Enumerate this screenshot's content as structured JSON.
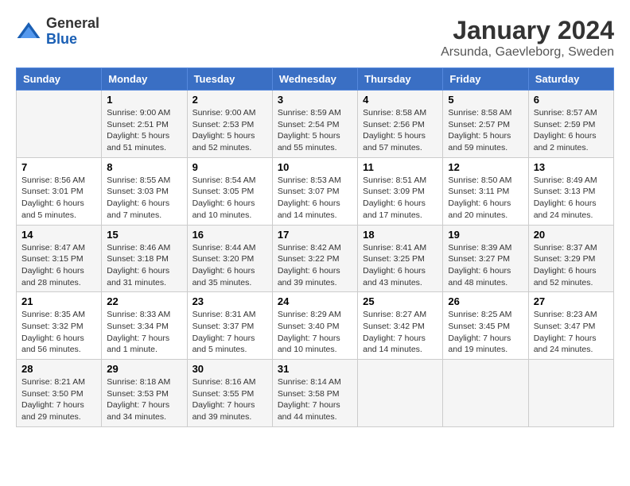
{
  "logo": {
    "general": "General",
    "blue": "Blue"
  },
  "header": {
    "month": "January 2024",
    "location": "Arsunda, Gaevleborg, Sweden"
  },
  "weekdays": [
    "Sunday",
    "Monday",
    "Tuesday",
    "Wednesday",
    "Thursday",
    "Friday",
    "Saturday"
  ],
  "weeks": [
    [
      {
        "day": "",
        "sunrise": "",
        "sunset": "",
        "daylight": ""
      },
      {
        "day": "1",
        "sunrise": "Sunrise: 9:00 AM",
        "sunset": "Sunset: 2:51 PM",
        "daylight": "Daylight: 5 hours and 51 minutes."
      },
      {
        "day": "2",
        "sunrise": "Sunrise: 9:00 AM",
        "sunset": "Sunset: 2:53 PM",
        "daylight": "Daylight: 5 hours and 52 minutes."
      },
      {
        "day": "3",
        "sunrise": "Sunrise: 8:59 AM",
        "sunset": "Sunset: 2:54 PM",
        "daylight": "Daylight: 5 hours and 55 minutes."
      },
      {
        "day": "4",
        "sunrise": "Sunrise: 8:58 AM",
        "sunset": "Sunset: 2:56 PM",
        "daylight": "Daylight: 5 hours and 57 minutes."
      },
      {
        "day": "5",
        "sunrise": "Sunrise: 8:58 AM",
        "sunset": "Sunset: 2:57 PM",
        "daylight": "Daylight: 5 hours and 59 minutes."
      },
      {
        "day": "6",
        "sunrise": "Sunrise: 8:57 AM",
        "sunset": "Sunset: 2:59 PM",
        "daylight": "Daylight: 6 hours and 2 minutes."
      }
    ],
    [
      {
        "day": "7",
        "sunrise": "Sunrise: 8:56 AM",
        "sunset": "Sunset: 3:01 PM",
        "daylight": "Daylight: 6 hours and 5 minutes."
      },
      {
        "day": "8",
        "sunrise": "Sunrise: 8:55 AM",
        "sunset": "Sunset: 3:03 PM",
        "daylight": "Daylight: 6 hours and 7 minutes."
      },
      {
        "day": "9",
        "sunrise": "Sunrise: 8:54 AM",
        "sunset": "Sunset: 3:05 PM",
        "daylight": "Daylight: 6 hours and 10 minutes."
      },
      {
        "day": "10",
        "sunrise": "Sunrise: 8:53 AM",
        "sunset": "Sunset: 3:07 PM",
        "daylight": "Daylight: 6 hours and 14 minutes."
      },
      {
        "day": "11",
        "sunrise": "Sunrise: 8:51 AM",
        "sunset": "Sunset: 3:09 PM",
        "daylight": "Daylight: 6 hours and 17 minutes."
      },
      {
        "day": "12",
        "sunrise": "Sunrise: 8:50 AM",
        "sunset": "Sunset: 3:11 PM",
        "daylight": "Daylight: 6 hours and 20 minutes."
      },
      {
        "day": "13",
        "sunrise": "Sunrise: 8:49 AM",
        "sunset": "Sunset: 3:13 PM",
        "daylight": "Daylight: 6 hours and 24 minutes."
      }
    ],
    [
      {
        "day": "14",
        "sunrise": "Sunrise: 8:47 AM",
        "sunset": "Sunset: 3:15 PM",
        "daylight": "Daylight: 6 hours and 28 minutes."
      },
      {
        "day": "15",
        "sunrise": "Sunrise: 8:46 AM",
        "sunset": "Sunset: 3:18 PM",
        "daylight": "Daylight: 6 hours and 31 minutes."
      },
      {
        "day": "16",
        "sunrise": "Sunrise: 8:44 AM",
        "sunset": "Sunset: 3:20 PM",
        "daylight": "Daylight: 6 hours and 35 minutes."
      },
      {
        "day": "17",
        "sunrise": "Sunrise: 8:42 AM",
        "sunset": "Sunset: 3:22 PM",
        "daylight": "Daylight: 6 hours and 39 minutes."
      },
      {
        "day": "18",
        "sunrise": "Sunrise: 8:41 AM",
        "sunset": "Sunset: 3:25 PM",
        "daylight": "Daylight: 6 hours and 43 minutes."
      },
      {
        "day": "19",
        "sunrise": "Sunrise: 8:39 AM",
        "sunset": "Sunset: 3:27 PM",
        "daylight": "Daylight: 6 hours and 48 minutes."
      },
      {
        "day": "20",
        "sunrise": "Sunrise: 8:37 AM",
        "sunset": "Sunset: 3:29 PM",
        "daylight": "Daylight: 6 hours and 52 minutes."
      }
    ],
    [
      {
        "day": "21",
        "sunrise": "Sunrise: 8:35 AM",
        "sunset": "Sunset: 3:32 PM",
        "daylight": "Daylight: 6 hours and 56 minutes."
      },
      {
        "day": "22",
        "sunrise": "Sunrise: 8:33 AM",
        "sunset": "Sunset: 3:34 PM",
        "daylight": "Daylight: 7 hours and 1 minute."
      },
      {
        "day": "23",
        "sunrise": "Sunrise: 8:31 AM",
        "sunset": "Sunset: 3:37 PM",
        "daylight": "Daylight: 7 hours and 5 minutes."
      },
      {
        "day": "24",
        "sunrise": "Sunrise: 8:29 AM",
        "sunset": "Sunset: 3:40 PM",
        "daylight": "Daylight: 7 hours and 10 minutes."
      },
      {
        "day": "25",
        "sunrise": "Sunrise: 8:27 AM",
        "sunset": "Sunset: 3:42 PM",
        "daylight": "Daylight: 7 hours and 14 minutes."
      },
      {
        "day": "26",
        "sunrise": "Sunrise: 8:25 AM",
        "sunset": "Sunset: 3:45 PM",
        "daylight": "Daylight: 7 hours and 19 minutes."
      },
      {
        "day": "27",
        "sunrise": "Sunrise: 8:23 AM",
        "sunset": "Sunset: 3:47 PM",
        "daylight": "Daylight: 7 hours and 24 minutes."
      }
    ],
    [
      {
        "day": "28",
        "sunrise": "Sunrise: 8:21 AM",
        "sunset": "Sunset: 3:50 PM",
        "daylight": "Daylight: 7 hours and 29 minutes."
      },
      {
        "day": "29",
        "sunrise": "Sunrise: 8:18 AM",
        "sunset": "Sunset: 3:53 PM",
        "daylight": "Daylight: 7 hours and 34 minutes."
      },
      {
        "day": "30",
        "sunrise": "Sunrise: 8:16 AM",
        "sunset": "Sunset: 3:55 PM",
        "daylight": "Daylight: 7 hours and 39 minutes."
      },
      {
        "day": "31",
        "sunrise": "Sunrise: 8:14 AM",
        "sunset": "Sunset: 3:58 PM",
        "daylight": "Daylight: 7 hours and 44 minutes."
      },
      {
        "day": "",
        "sunrise": "",
        "sunset": "",
        "daylight": ""
      },
      {
        "day": "",
        "sunrise": "",
        "sunset": "",
        "daylight": ""
      },
      {
        "day": "",
        "sunrise": "",
        "sunset": "",
        "daylight": ""
      }
    ]
  ]
}
